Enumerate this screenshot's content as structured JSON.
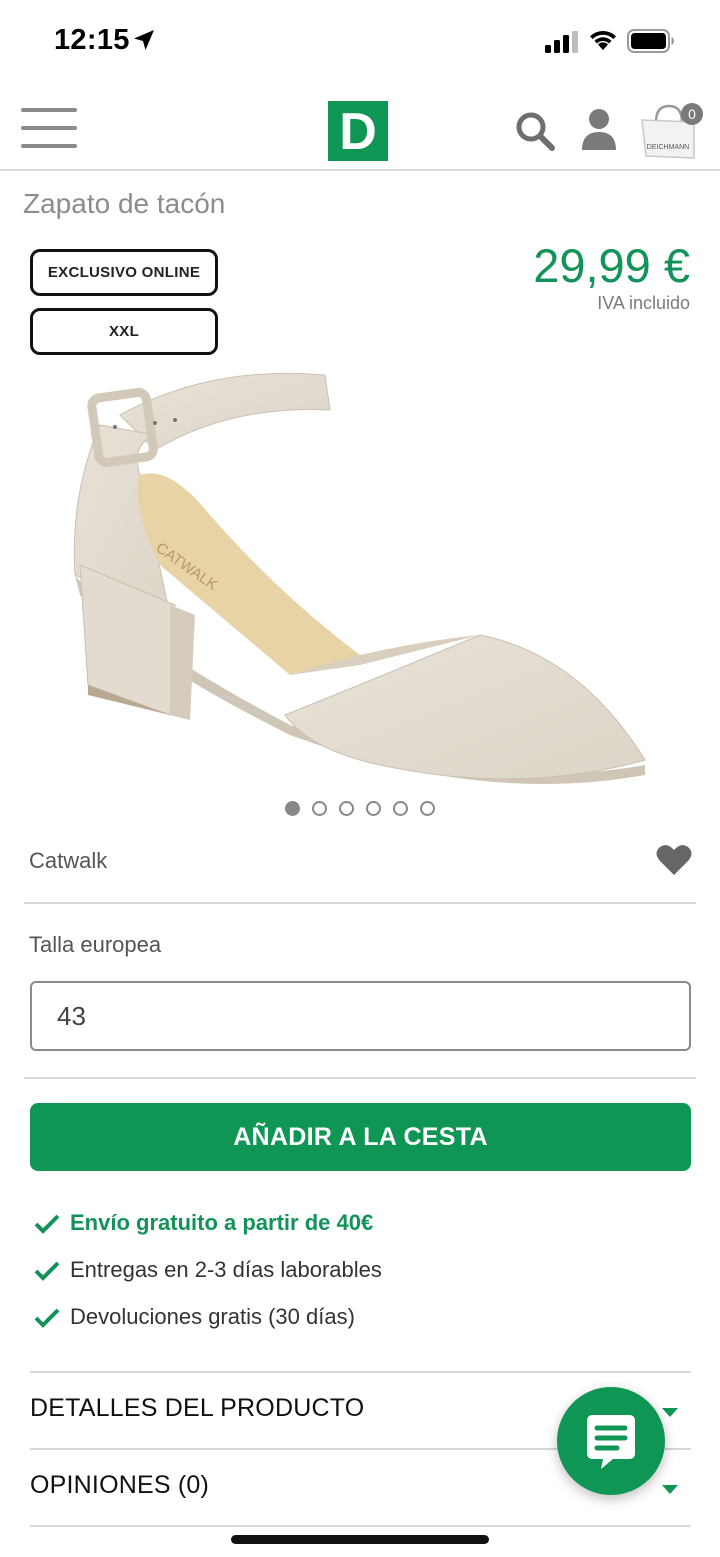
{
  "status_bar": {
    "time": "12:15"
  },
  "header": {
    "logo_letter": "D",
    "cart_count": "0",
    "cart_brand": "DEICHMANN"
  },
  "product": {
    "title": "Zapato de tacón",
    "badges": [
      "EXCLUSIVO ONLINE",
      "XXL"
    ],
    "price": "29,99 €",
    "vat_note": "IVA incluido",
    "brand": "Catwalk",
    "image_count": 6,
    "active_image_index": 0,
    "insole_text": "CATWALK"
  },
  "size": {
    "label": "Talla europea",
    "value": "43"
  },
  "cart_button": {
    "label": "AÑADIR A LA CESTA"
  },
  "benefits": [
    "Envío gratuito a partir de 40€",
    "Entregas en 2-3 días laborables",
    "Devoluciones gratis (30 días)"
  ],
  "accordions": [
    {
      "label": "DETALLES DEL PRODUCTO"
    },
    {
      "label": "OPINIONES (0)"
    }
  ],
  "colors": {
    "brand_green": "#0f9554",
    "price_green": "#13935a"
  }
}
